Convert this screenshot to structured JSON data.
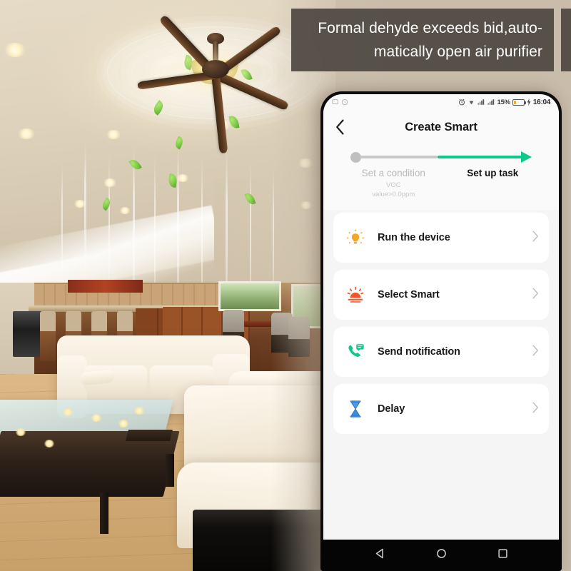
{
  "caption": {
    "line1": "Formal dehyde exceeds bid,auto-",
    "line2": "matically open air purifier"
  },
  "phone": {
    "statusbar": {
      "battery_percent": "15%",
      "time": "16:04",
      "icons": [
        "alarm-icon",
        "wifi-icon",
        "signal-icon",
        "signal-icon",
        "battery-icon",
        "charging-bolt-icon"
      ]
    },
    "header": {
      "back_label": "‹",
      "title": "Create Smart"
    },
    "stepper": {
      "step1": {
        "label": "Set a condition",
        "sub_line1": "VOC",
        "sub_line2": "value>0.0ppm",
        "state": "completed",
        "color": "#b9b9b9"
      },
      "step2": {
        "label": "Set up task",
        "state": "active",
        "color": "#141414"
      },
      "track_gray": "#c8c8c8",
      "track_green": "#0ec98a"
    },
    "actions": [
      {
        "label": "Run the device",
        "icon": "light-bulb-icon",
        "color": "#f5a623"
      },
      {
        "label": "Select Smart",
        "icon": "sunrise-icon",
        "color": "#f4542a"
      },
      {
        "label": "Send notification",
        "icon": "phone-message-icon",
        "color": "#0ec98a"
      },
      {
        "label": "Delay",
        "icon": "hourglass-icon",
        "color": "#3d8bdb"
      }
    ],
    "android_nav": [
      "back-triangle-icon",
      "home-circle-icon",
      "recents-square-icon"
    ]
  },
  "scene": {
    "description": "ceiling-fan-living-room-photo"
  }
}
